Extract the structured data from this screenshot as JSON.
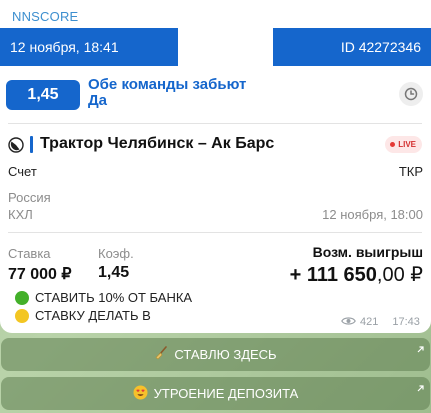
{
  "message": {
    "sender": "NNSCORE",
    "ticket": {
      "date": "12 ноября, 18:41",
      "id": "ID 42272346"
    },
    "bet": {
      "coefficient": "1,45",
      "name_line1": "Обе команды забьют",
      "name_line2": "Да"
    },
    "match": {
      "title": "Трактор Челябинск – Ак Барс",
      "live_badge": "LIVE",
      "score_label": "Счет",
      "score_value": "ТКР",
      "country": "Россия",
      "league": "КХЛ",
      "date": "12 ноября, 18:00"
    },
    "stake": {
      "stake_label": "Ставка",
      "stake_value": "77 000 ₽",
      "coef_label": "Коэф.",
      "coef_value": "1,45",
      "win_label": "Возм. выигрыш",
      "win_value_main": "+ 111 650",
      "win_value_frac": ",00 ₽"
    },
    "notes": [
      {
        "icon": "green-circle-icon",
        "text": "СТАВИТЬ 10% ОТ БАНКА"
      },
      {
        "icon": "yellow-circle-icon",
        "text": "СТАВКУ ДЕЛАТЬ В"
      }
    ],
    "views": "421",
    "time": "17:43"
  },
  "buttons": [
    {
      "icon": "broom-icon",
      "label": "СТАВЛЮ ЗДЕСЬ"
    },
    {
      "icon": "heart-eyes-icon",
      "label": "УТРОЕНИЕ ДЕПОЗИТА"
    }
  ],
  "colors": {
    "accent": "#1566cc",
    "sender": "#3d8fcf",
    "live": "#e53935",
    "background": "#a9c59a"
  }
}
